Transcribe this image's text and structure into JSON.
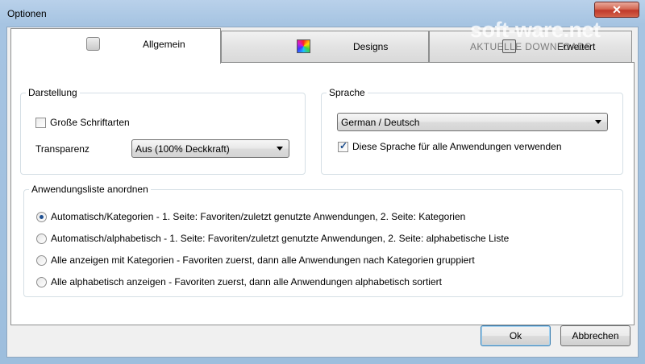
{
  "window": {
    "title": "Optionen"
  },
  "tabs": [
    {
      "label": "Allgemein",
      "active": true
    },
    {
      "label": "Designs",
      "active": false
    },
    {
      "label": "Erweitert",
      "active": false
    }
  ],
  "darstellung": {
    "title": "Darstellung",
    "large_fonts_label": "Große Schriftarten",
    "large_fonts_checked": false,
    "transparency_label": "Transparenz",
    "transparency_value": "Aus (100% Deckkraft)"
  },
  "sprache": {
    "title": "Sprache",
    "language_value": "German / Deutsch",
    "all_apps_label": "Diese Sprache für alle Anwendungen verwenden",
    "all_apps_checked": true
  },
  "app_list": {
    "title": "Anwendungsliste anordnen",
    "options": [
      {
        "label": "Automatisch/Kategorien - 1. Seite: Favoriten/zuletzt genutzte Anwendungen, 2. Seite: Kategorien",
        "selected": true
      },
      {
        "label": "Automatisch/alphabetisch - 1. Seite: Favoriten/zuletzt genutzte Anwendungen, 2. Seite: alphabetische Liste",
        "selected": false
      },
      {
        "label": "Alle anzeigen mit Kategorien - Favoriten zuerst, dann alle Anwendungen nach Kategorien gruppiert",
        "selected": false
      },
      {
        "label": "Alle alphabetisch anzeigen  - Favoriten zuerst, dann alle Anwendungen alphabetisch sortiert",
        "selected": false
      }
    ]
  },
  "buttons": {
    "ok": "Ok",
    "cancel": "Abbrechen"
  },
  "watermark": {
    "brand": "soft-ware.net",
    "tagline": "AKTUELLE DOWNLOADS"
  }
}
